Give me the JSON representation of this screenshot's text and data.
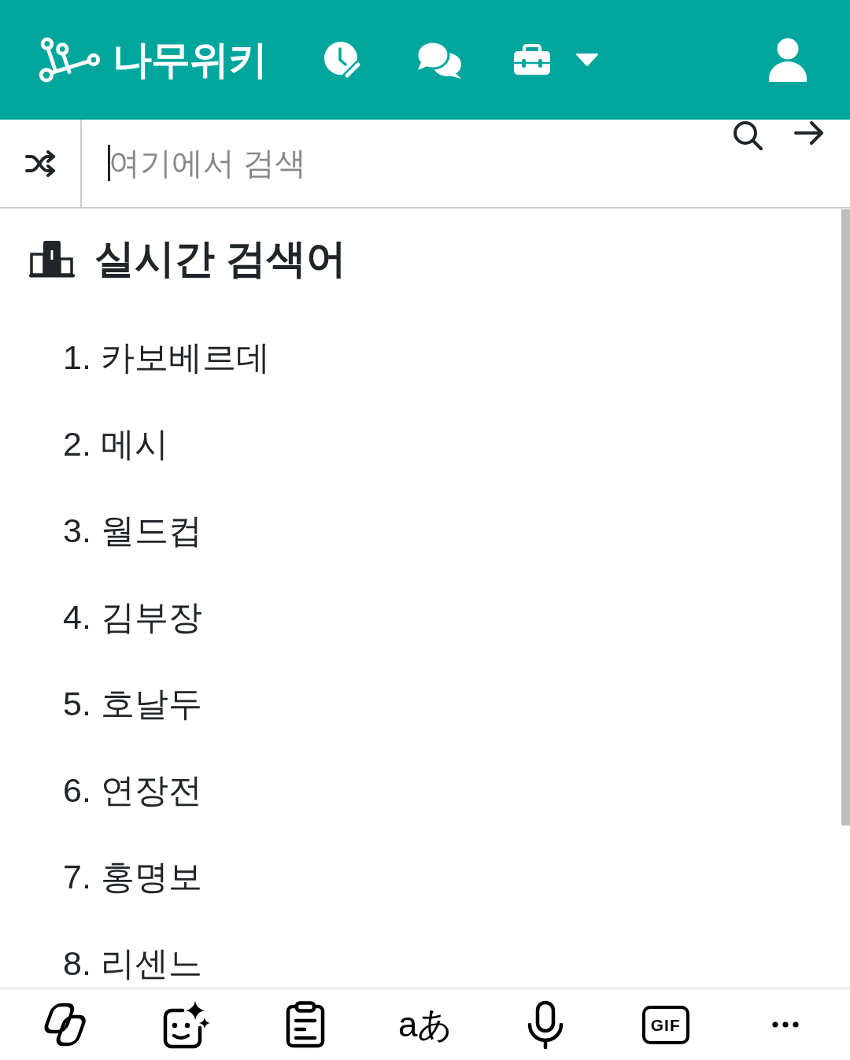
{
  "header": {
    "logo_text": "나무위키"
  },
  "search": {
    "placeholder": "여기에서 검색",
    "focused": true
  },
  "trending": {
    "title": "실시간 검색어",
    "items": [
      {
        "rank": "1.",
        "term": "카보베르데"
      },
      {
        "rank": "2.",
        "term": "메시"
      },
      {
        "rank": "3.",
        "term": "월드컵"
      },
      {
        "rank": "4.",
        "term": "김부장"
      },
      {
        "rank": "5.",
        "term": "호날두"
      },
      {
        "rank": "6.",
        "term": "연장전"
      },
      {
        "rank": "7.",
        "term": "홍명보"
      },
      {
        "rank": "8.",
        "term": "리센느"
      }
    ]
  },
  "keyboard_toolbar": {
    "translate_label": "aあ",
    "gif_label": "GIF"
  }
}
